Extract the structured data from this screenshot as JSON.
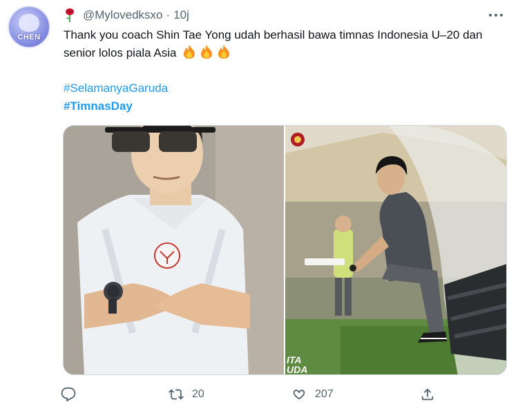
{
  "tweet": {
    "handle": "@Mylovedksxo",
    "separator": "·",
    "time": "10j",
    "text": "Thank you coach Shin Tae Yong udah berhasil bawa timnas Indonesia U–20 dan senior lolos piala Asia",
    "emoji": [
      "fire-emoji",
      "fire-emoji",
      "fire-emoji"
    ],
    "hashtags": [
      "#SelamanyaGaruda",
      "#TimnasDay"
    ],
    "avatar_text": "CHEN"
  },
  "actions": {
    "reply_count": "",
    "retweet_count": "20",
    "like_count": "207",
    "share_count": ""
  },
  "colors": {
    "link": "#1d9bf0",
    "muted": "#536471",
    "text": "#0f1419"
  },
  "icons": [
    "rose-icon",
    "more-icon",
    "reply-icon",
    "retweet-icon",
    "like-icon",
    "share-icon"
  ]
}
